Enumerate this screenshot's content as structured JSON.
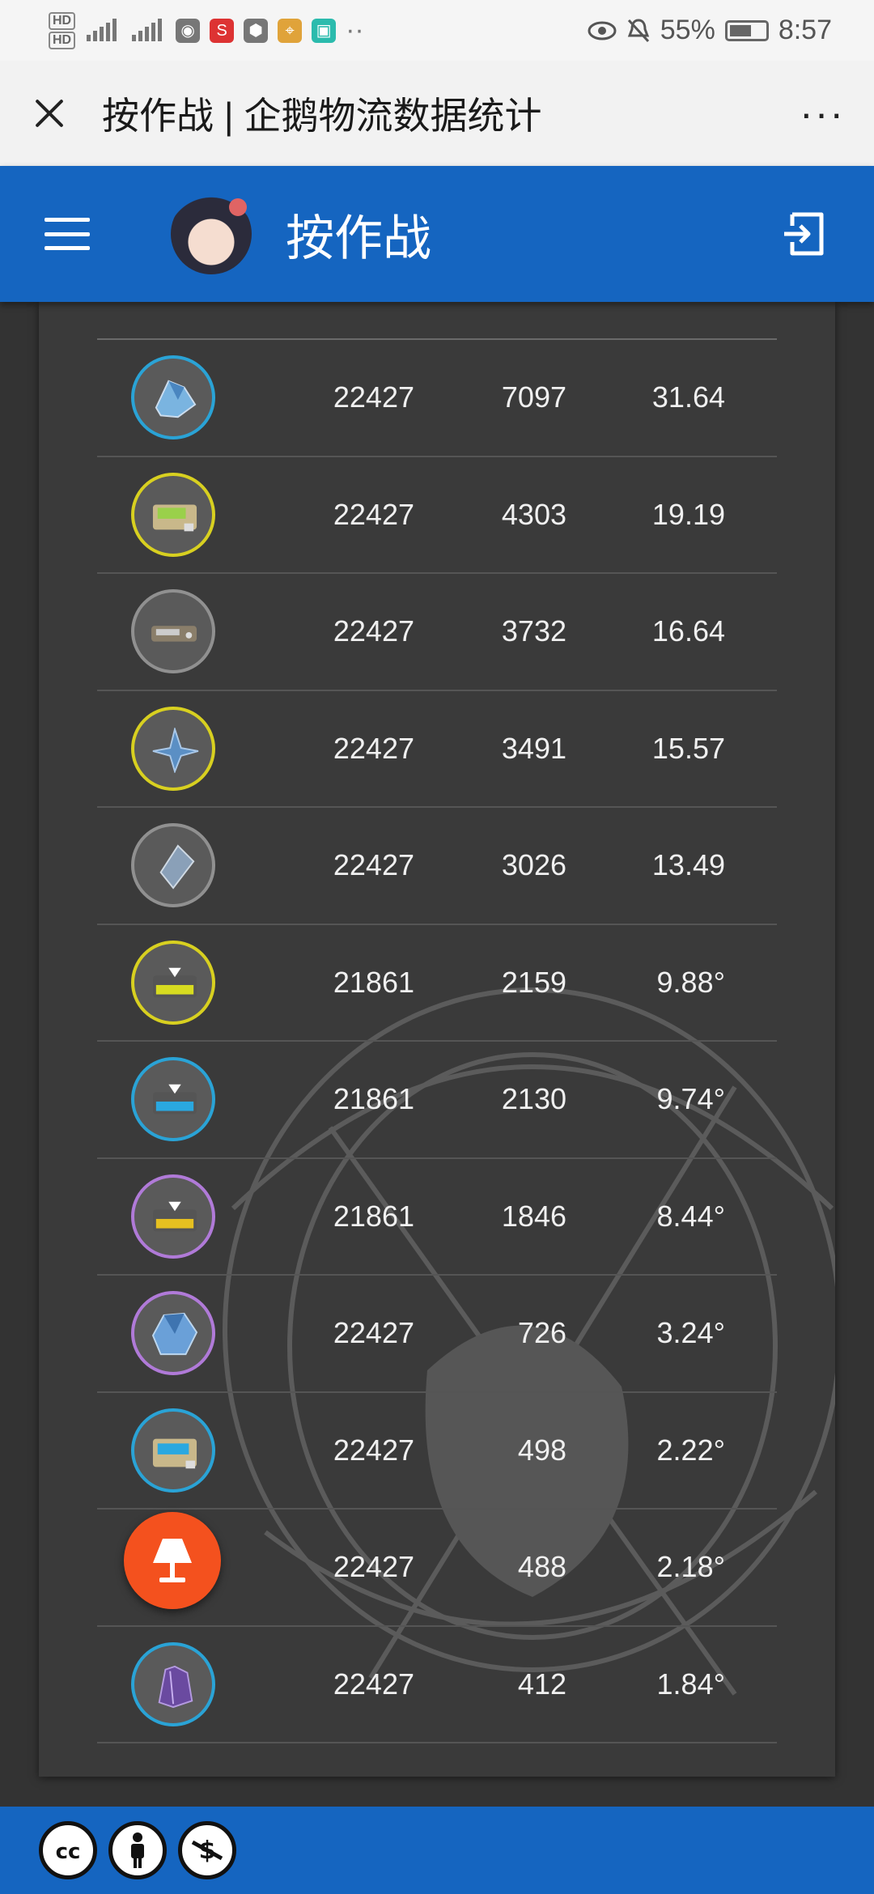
{
  "status_bar": {
    "hd1": "HD",
    "hd2": "HD",
    "battery": "55%",
    "time": "8:57"
  },
  "title_bar": {
    "title": "按作战 | 企鹅物流数据统计",
    "more": "···"
  },
  "header": {
    "title": "按作战"
  },
  "rows": [
    {
      "icon": "blue-crystal-cluster-icon",
      "ring": "blue",
      "times": "22427",
      "quantity": "7097",
      "rate": "31.64"
    },
    {
      "icon": "green-device-icon",
      "ring": "yellow",
      "times": "22427",
      "quantity": "4303",
      "rate": "19.19"
    },
    {
      "icon": "gray-device-icon",
      "ring": "gray",
      "times": "22427",
      "quantity": "3732",
      "rate": "16.64"
    },
    {
      "icon": "blue-crystal-star-icon",
      "ring": "yellow",
      "times": "22427",
      "quantity": "3491",
      "rate": "15.57"
    },
    {
      "icon": "gray-crystal-shard-icon",
      "ring": "gray",
      "times": "22427",
      "quantity": "3026",
      "rate": "13.49"
    },
    {
      "icon": "yellow-chip-icon",
      "ring": "yellow",
      "times": "21861",
      "quantity": "2159",
      "rate": "9.88°"
    },
    {
      "icon": "blue-chip-icon",
      "ring": "blue",
      "times": "21861",
      "quantity": "2130",
      "rate": "9.74°"
    },
    {
      "icon": "gold-chip-icon",
      "ring": "purple",
      "times": "21861",
      "quantity": "1846",
      "rate": "8.44°"
    },
    {
      "icon": "large-blue-crystal-icon",
      "ring": "purple",
      "times": "22427",
      "quantity": "726",
      "rate": "3.24°"
    },
    {
      "icon": "blue-device-icon",
      "ring": "blue",
      "times": "22427",
      "quantity": "498",
      "rate": "2.22°"
    },
    {
      "icon": "unknown-item-icon",
      "ring": "gray",
      "times": "22427",
      "quantity": "488",
      "rate": "2.18°"
    },
    {
      "icon": "purple-crystal-icon",
      "ring": "blue",
      "times": "22427",
      "quantity": "412",
      "rate": "1.84°"
    }
  ],
  "footer": {
    "badges": [
      "cc",
      "by",
      "nc"
    ]
  },
  "colors": {
    "primary": "#1565c0",
    "fab": "#f4511e",
    "card": "#3a3a3a"
  }
}
